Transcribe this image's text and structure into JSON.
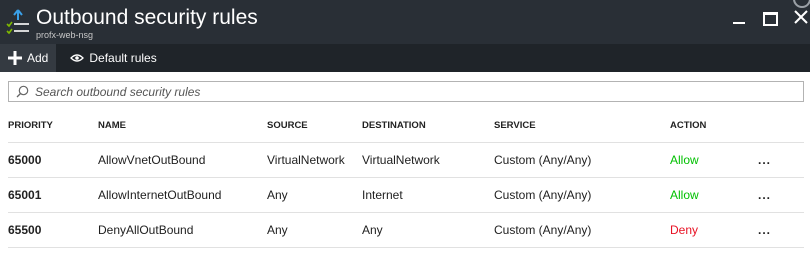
{
  "header": {
    "title": "Outbound security rules",
    "subtitle": "profx-web-nsg"
  },
  "commands": {
    "add_label": "Add",
    "default_rules_label": "Default rules"
  },
  "search": {
    "placeholder": "Search outbound security rules"
  },
  "table": {
    "columns": [
      "PRIORITY",
      "NAME",
      "SOURCE",
      "DESTINATION",
      "SERVICE",
      "ACTION"
    ],
    "rows": [
      {
        "priority": "65000",
        "name": "AllowVnetOutBound",
        "source": "VirtualNetwork",
        "destination": "VirtualNetwork",
        "service": "Custom (Any/Any)",
        "action": "Allow",
        "more": "..."
      },
      {
        "priority": "65001",
        "name": "AllowInternetOutBound",
        "source": "Any",
        "destination": "Internet",
        "service": "Custom (Any/Any)",
        "action": "Allow",
        "more": "..."
      },
      {
        "priority": "65500",
        "name": "DenyAllOutBound",
        "source": "Any",
        "destination": "Any",
        "service": "Custom (Any/Any)",
        "action": "Deny",
        "more": "..."
      }
    ]
  },
  "colors": {
    "header_bg": "#292f36",
    "command_bar_bg": "#1f2429",
    "allow": "#00c000",
    "deny": "#e81123",
    "icon_blue": "#3aa0e8",
    "icon_green": "#7fba00"
  }
}
